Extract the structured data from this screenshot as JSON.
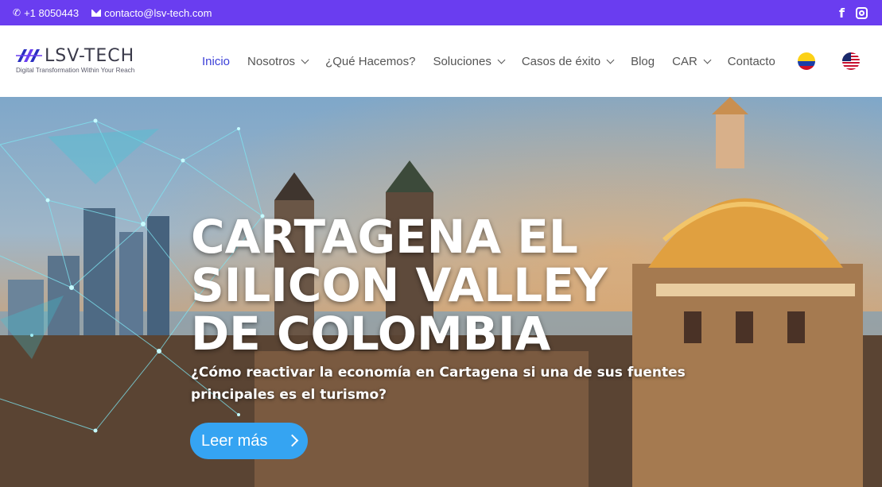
{
  "topbar": {
    "phone": "+1 8050443",
    "email": "contacto@lsv-tech.com",
    "social": [
      "facebook-icon",
      "instagram-icon"
    ],
    "bg_color": "#6a3df0"
  },
  "logo": {
    "name": "LSV-TECH",
    "tagline": "Digital Transformation Within Your Reach"
  },
  "nav": {
    "items": [
      {
        "label": "Inicio",
        "active": true,
        "dropdown": false
      },
      {
        "label": "Nosotros",
        "active": false,
        "dropdown": true
      },
      {
        "label": "¿Qué Hacemos?",
        "active": false,
        "dropdown": false
      },
      {
        "label": "Soluciones",
        "active": false,
        "dropdown": true
      },
      {
        "label": "Casos de éxito",
        "active": false,
        "dropdown": true
      },
      {
        "label": "Blog",
        "active": false,
        "dropdown": false
      },
      {
        "label": "CAR",
        "active": false,
        "dropdown": true
      },
      {
        "label": "Contacto",
        "active": false,
        "dropdown": false
      }
    ],
    "active_color": "#3b3fd8",
    "languages": [
      "colombia-flag-icon",
      "usa-flag-icon"
    ]
  },
  "hero": {
    "title_lines": [
      "CARTAGENA EL",
      "SILICON VALLEY",
      "DE COLOMBIA"
    ],
    "subtitle_lines": [
      "¿Cómo reactivar la economía en Cartagena si una de sus fuentes",
      "principales es el turismo?"
    ],
    "cta_label": "Leer más",
    "cta_color": "#35a4f2"
  }
}
